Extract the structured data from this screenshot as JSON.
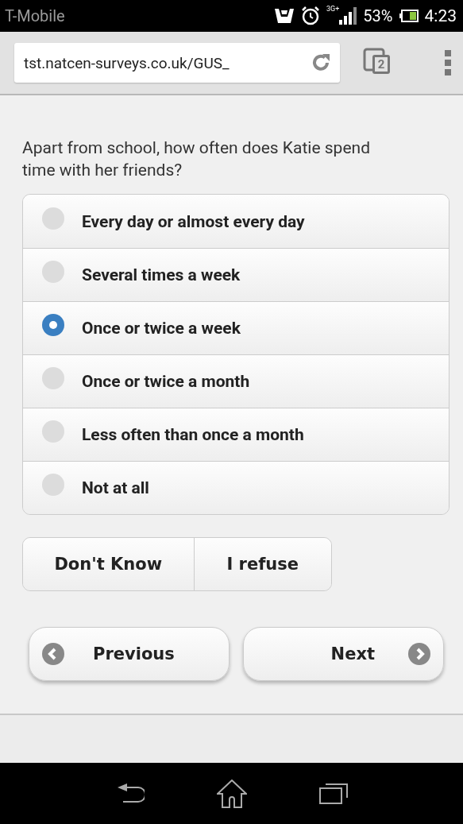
{
  "status_bar": {
    "carrier": "T-Mobile",
    "network": "3G+",
    "battery": "53%",
    "time": "4:23"
  },
  "browser": {
    "url": "tst.natcen-surveys.co.uk/GUS_",
    "tab_count": "2"
  },
  "question": "Apart from school, how often does Katie spend time with her friends?",
  "options": [
    {
      "label": "Every day or almost every day",
      "selected": false
    },
    {
      "label": "Several times a week",
      "selected": false
    },
    {
      "label": "Once or twice a week",
      "selected": true
    },
    {
      "label": "Once or twice a month",
      "selected": false
    },
    {
      "label": "Less often than once a month",
      "selected": false
    },
    {
      "label": "Not at all",
      "selected": false
    }
  ],
  "extra_buttons": [
    "Don't Know",
    "I refuse"
  ],
  "navigation": {
    "previous": "Previous",
    "next": "Next"
  }
}
